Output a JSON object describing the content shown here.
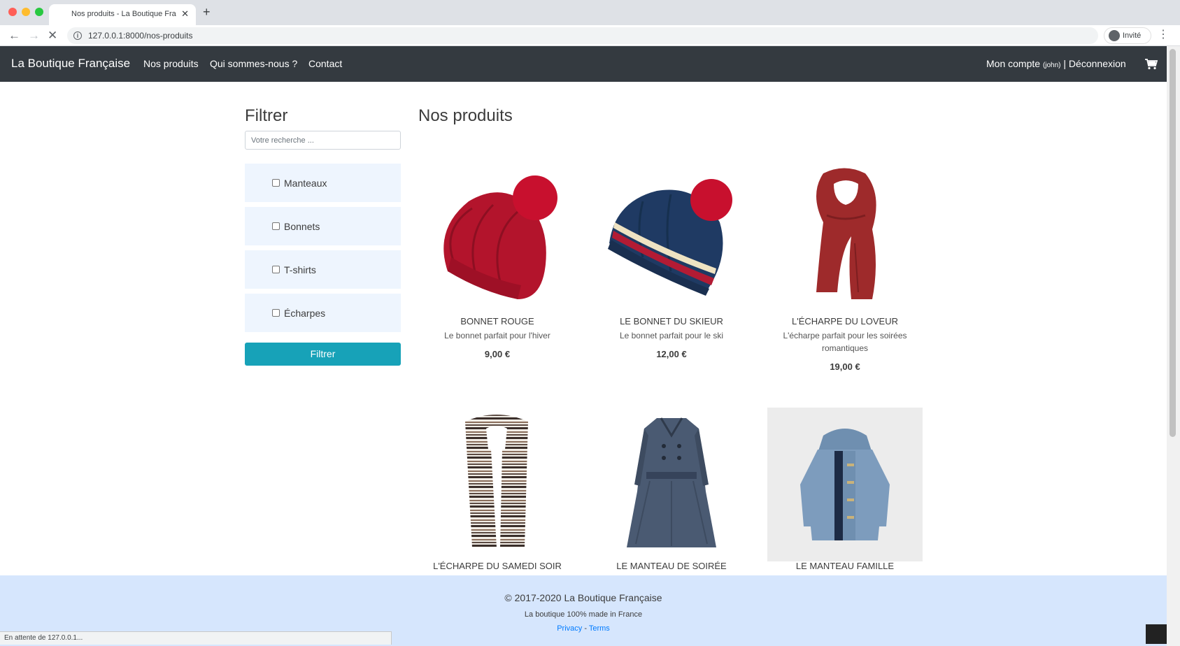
{
  "browser": {
    "tab_title": "Nos produits - La Boutique Fra",
    "url": "127.0.0.1:8000/nos-produits",
    "profile_label": "Invité",
    "status_text": "En attente de 127.0.0.1..."
  },
  "navbar": {
    "brand": "La Boutique Française",
    "links": [
      "Nos produits",
      "Qui sommes-nous ?",
      "Contact"
    ],
    "account_label": "Mon compte",
    "account_user": "(john)",
    "logout_label": "| Déconnexion"
  },
  "sidebar": {
    "title": "Filtrer",
    "search_placeholder": "Votre recherche ...",
    "categories": [
      "Manteaux",
      "Bonnets",
      "T-shirts",
      "Écharpes"
    ],
    "filter_button": "Filtrer"
  },
  "main": {
    "title": "Nos produits",
    "products": [
      {
        "name": "BONNET ROUGE",
        "description": "Le bonnet parfait pour l'hiver",
        "price": "9,00 €"
      },
      {
        "name": "LE BONNET DU SKIEUR",
        "description": "Le bonnet parfait pour le ski",
        "price": "12,00 €"
      },
      {
        "name": "L'ÉCHARPE DU LOVEUR",
        "description": "L'écharpe parfait pour les soirées romantiques",
        "price": "19,00 €"
      },
      {
        "name": "L'ÉCHARPE DU SAMEDI SOIR"
      },
      {
        "name": "LE MANTEAU DE SOIRÉE"
      },
      {
        "name": "LE MANTEAU FAMILLE"
      }
    ]
  },
  "footer": {
    "copyright": "© 2017-2020 La Boutique Française",
    "tagline": "La boutique 100% made in France",
    "privacy": "Privacy",
    "separator": " - ",
    "terms": "Terms"
  },
  "colors": {
    "navbar_bg": "#343a40",
    "filter_button": "#17a2b8",
    "category_bg": "#eef5fe",
    "footer_bg": "#d6e6fd",
    "link": "#007bff"
  }
}
